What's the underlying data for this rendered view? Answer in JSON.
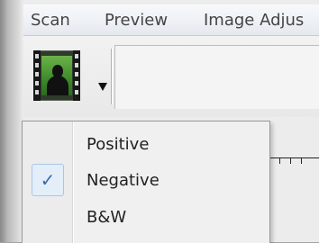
{
  "menubar": {
    "items": [
      "Scan",
      "Preview",
      "Image Adjus"
    ]
  },
  "toolbar": {
    "film_button_icon": "film-frame-icon",
    "dropdown_icon": "dropdown-arrow-icon"
  },
  "popup": {
    "items": [
      {
        "label": "Positive",
        "checked": false
      },
      {
        "label": "Negative",
        "checked": true
      },
      {
        "label": "B&W",
        "checked": false
      }
    ],
    "check_glyph": "✓"
  },
  "colors": {
    "check": "#3a6ea5",
    "check_bg": "#e3eef9",
    "menu_bg": "#f0f0f0"
  }
}
